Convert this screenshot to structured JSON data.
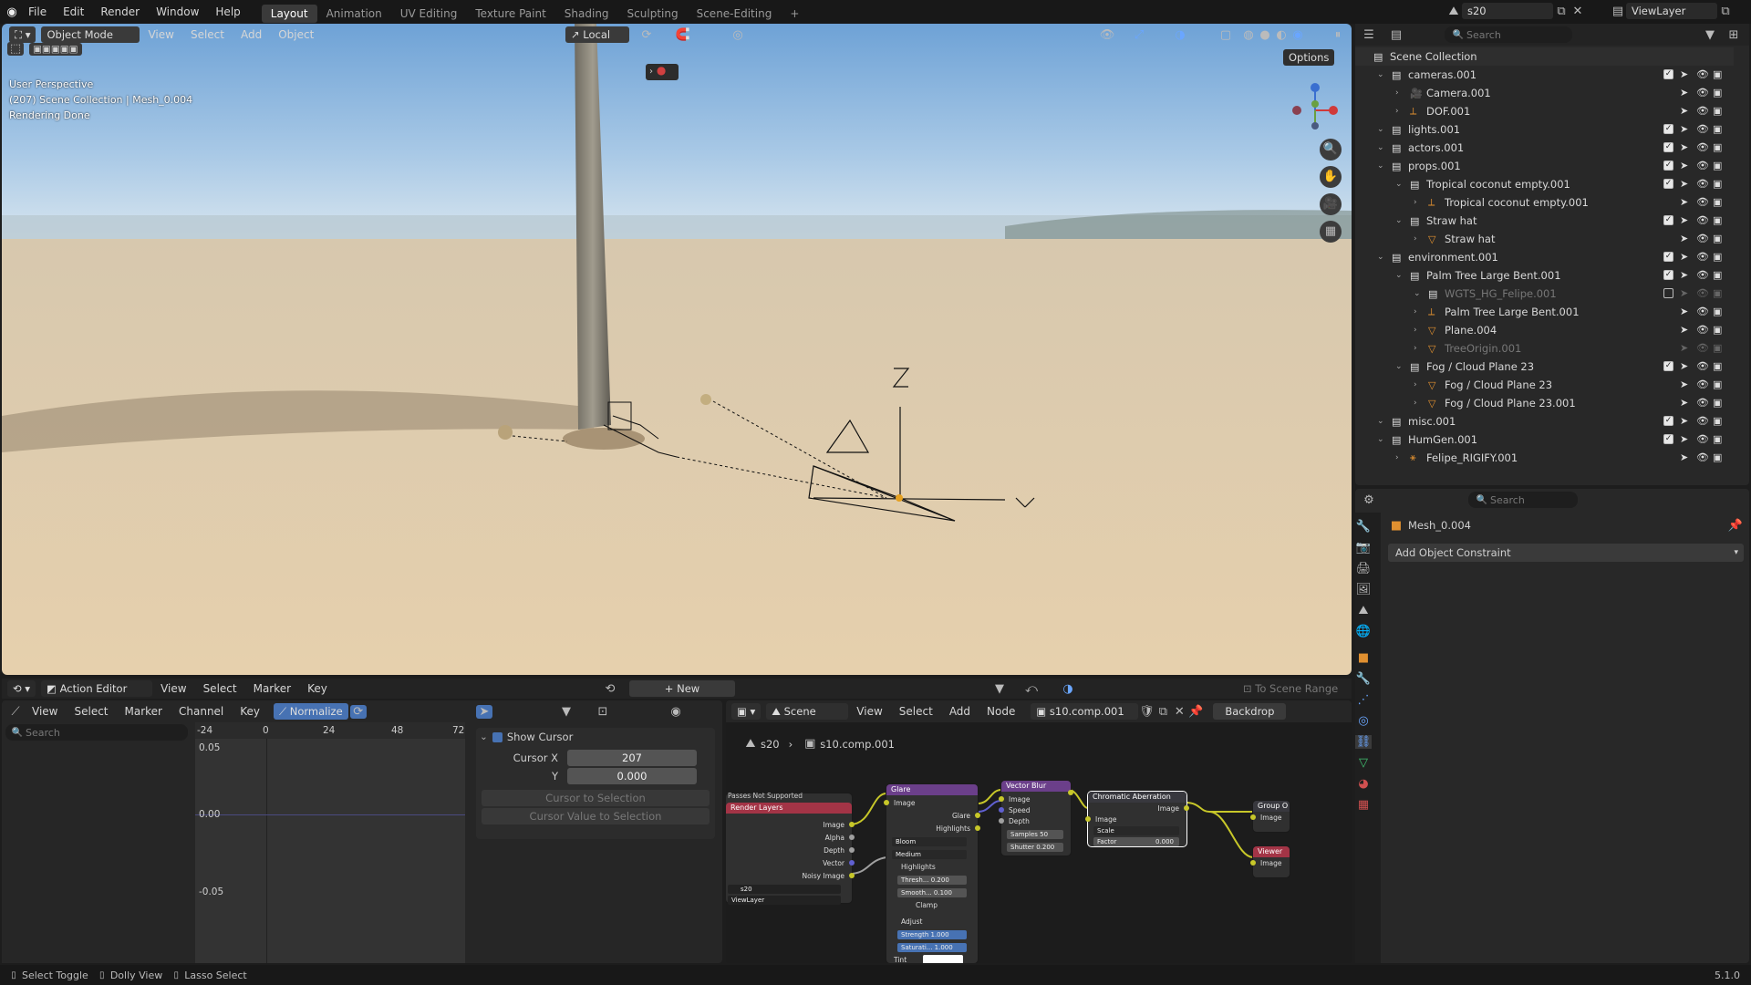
{
  "topbar": {
    "menus": [
      "File",
      "Edit",
      "Render",
      "Window",
      "Help"
    ],
    "workspaces": [
      "Layout",
      "Animation",
      "UV Editing",
      "Texture Paint",
      "Shading",
      "Sculpting",
      "Scene-Editing"
    ],
    "active_workspace": "Layout",
    "scene": "s20",
    "view_layer": "ViewLayer"
  },
  "viewport": {
    "mode": "Object Mode",
    "menus": [
      "View",
      "Select",
      "Add",
      "Object"
    ],
    "transform": "Local",
    "options": "Options",
    "overlay_line1": "User Perspective",
    "overlay_line2": "(207) Scene Collection | Mesh_0.004",
    "overlay_line3": "Rendering Done"
  },
  "outliner": {
    "search_placeholder": "Search",
    "items": [
      {
        "label": "Scene Collection",
        "indent": 0,
        "type": "collection",
        "checked": null
      },
      {
        "label": "cameras.001",
        "indent": 1,
        "type": "collection",
        "checked": true
      },
      {
        "label": "Camera.001",
        "indent": 2,
        "type": "camera",
        "checked": null
      },
      {
        "label": "DOF.001",
        "indent": 2,
        "type": "empty",
        "checked": null
      },
      {
        "label": "lights.001",
        "indent": 1,
        "type": "collection",
        "checked": true
      },
      {
        "label": "actors.001",
        "indent": 1,
        "type": "collection",
        "checked": true
      },
      {
        "label": "props.001",
        "indent": 1,
        "type": "collection",
        "checked": true
      },
      {
        "label": "Tropical coconut empty.001",
        "indent": 2,
        "type": "collection",
        "checked": true
      },
      {
        "label": "Tropical coconut empty.001",
        "indent": 3,
        "type": "empty",
        "checked": null
      },
      {
        "label": "Straw hat",
        "indent": 2,
        "type": "collection",
        "checked": true
      },
      {
        "label": "Straw hat",
        "indent": 3,
        "type": "mesh",
        "checked": null
      },
      {
        "label": "environment.001",
        "indent": 1,
        "type": "collection",
        "checked": true
      },
      {
        "label": "Palm Tree Large Bent.001",
        "indent": 2,
        "type": "collection",
        "checked": true
      },
      {
        "label": "WGTS_HG_Felipe.001",
        "indent": 3,
        "type": "collection",
        "checked": false,
        "dim": true
      },
      {
        "label": "Palm Tree Large Bent.001",
        "indent": 3,
        "type": "empty",
        "checked": null
      },
      {
        "label": "Plane.004",
        "indent": 3,
        "type": "mesh",
        "checked": null
      },
      {
        "label": "TreeOrigin.001",
        "indent": 3,
        "type": "mesh",
        "checked": null,
        "dim": true
      },
      {
        "label": "Fog / Cloud Plane 23",
        "indent": 2,
        "type": "collection",
        "checked": true
      },
      {
        "label": "Fog / Cloud Plane 23",
        "indent": 3,
        "type": "mesh",
        "checked": null
      },
      {
        "label": "Fog / Cloud Plane 23.001",
        "indent": 3,
        "type": "mesh",
        "checked": null
      },
      {
        "label": "misc.001",
        "indent": 1,
        "type": "collection",
        "checked": true
      },
      {
        "label": "HumGen.001",
        "indent": 1,
        "type": "collection",
        "checked": true
      },
      {
        "label": "Felipe_RIGIFY.001",
        "indent": 2,
        "type": "armature",
        "checked": null
      }
    ]
  },
  "properties": {
    "search_placeholder": "Search",
    "object_name": "Mesh_0.004",
    "add_constraint": "Add Object Constraint"
  },
  "action_editor": {
    "editor": "Action Editor",
    "menus": [
      "View",
      "Select",
      "Marker",
      "Key"
    ],
    "new_label": "New",
    "to_scene_range": "To Scene Range"
  },
  "graph": {
    "menus": [
      "View",
      "Select",
      "Marker",
      "Channel",
      "Key"
    ],
    "normalize": "Normalize",
    "search_placeholder": "Search",
    "frames": [
      "-24",
      "0",
      "24",
      "48",
      "72"
    ],
    "values": [
      "0.05",
      "0.00",
      "-0.05"
    ]
  },
  "cursor_panel": {
    "title": "Show Cursor",
    "cursor_x_label": "Cursor X",
    "cursor_x": "207",
    "y_label": "Y",
    "y": "0.000",
    "to_selection": "Cursor to Selection",
    "value_to_selection": "Cursor Value to Selection"
  },
  "compositor": {
    "scene": "Scene",
    "menus": [
      "View",
      "Select",
      "Add",
      "Node"
    ],
    "node_tree": "s10.comp.001",
    "backdrop": "Backdrop",
    "breadcrumb_scene": "s20",
    "breadcrumb_tree": "s10.comp.001",
    "render_layers": {
      "warning": "Passes Not Supported",
      "title": "Render Layers",
      "outputs": [
        "Image",
        "Alpha",
        "Depth",
        "Vector",
        "Noisy Image"
      ],
      "scene": "s20",
      "layer": "ViewLayer"
    },
    "glare": {
      "title": "Glare",
      "input": "Image",
      "outputs": [
        "Glare",
        "Highlights"
      ],
      "type": "Bloom",
      "quality": "Medium",
      "highlights": "Highlights",
      "threshold": "Thresh... 0.200",
      "smooth": "Smooth... 0.100",
      "clamp": "Clamp",
      "adjust": "Adjust",
      "strength": "Strength 1.000",
      "saturation": "Saturati... 1.000",
      "tint": "Tint"
    },
    "vector_blur": {
      "title": "Vector Blur",
      "inputs": [
        "Image",
        "Speed",
        "Depth"
      ],
      "samples": "Samples 50",
      "shutter": "Shutter 0.200"
    },
    "chromatic": {
      "title": "Chromatic Aberration",
      "output": "Image",
      "input": "Image",
      "scale": "Scale",
      "factor": "Factor",
      "factor_val": "0.000"
    },
    "group_out": {
      "title": "Group O",
      "input": "Image"
    },
    "viewer": {
      "title": "Viewer",
      "input": "Image"
    }
  },
  "statusbar": {
    "items": [
      "Select Toggle",
      "Dolly View",
      "Lasso Select"
    ],
    "version": "5.1.0"
  }
}
